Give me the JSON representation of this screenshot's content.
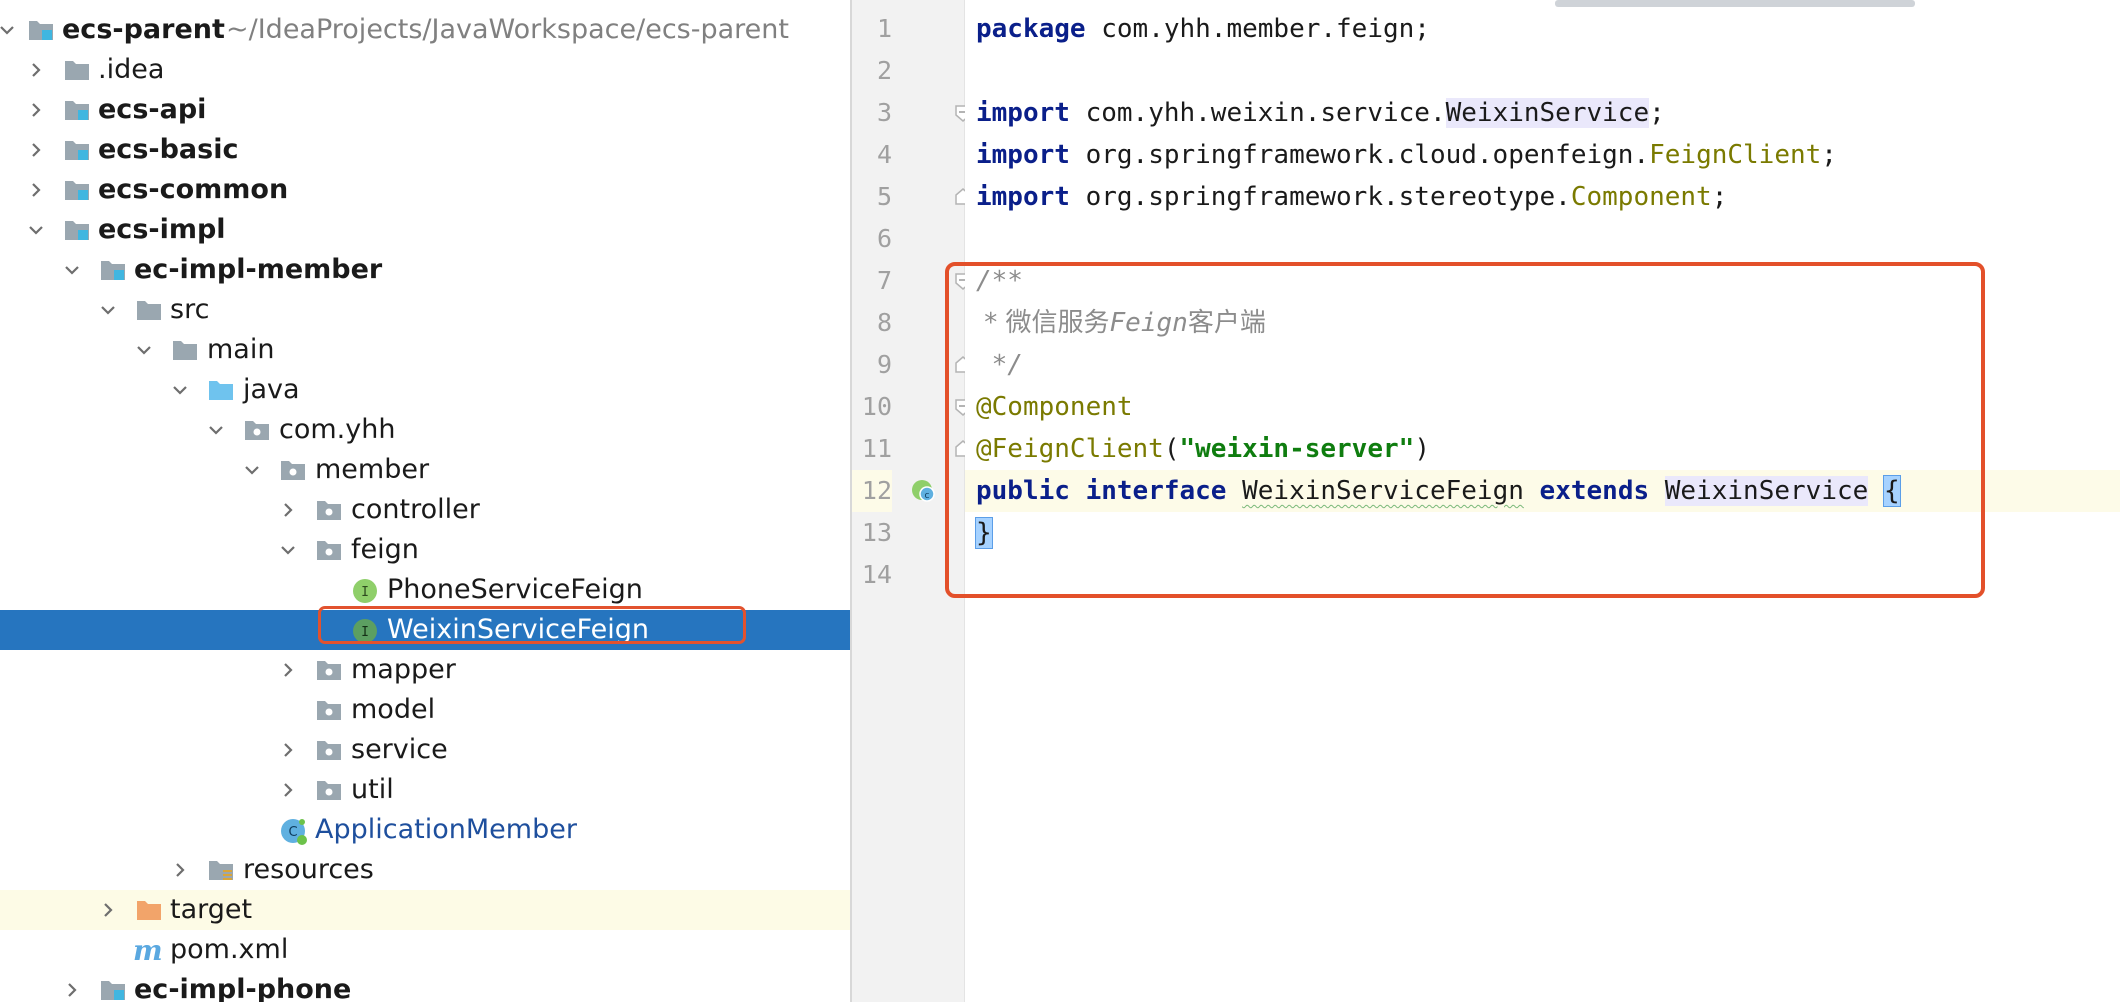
{
  "tree": {
    "root": {
      "name": "ecs-parent",
      "path": "~/IdeaProjects/JavaWorkspace/ecs-parent"
    },
    "nodes": [
      {
        "label": ".idea"
      },
      {
        "label": "ecs-api"
      },
      {
        "label": "ecs-basic"
      },
      {
        "label": "ecs-common"
      },
      {
        "label": "ecs-impl"
      },
      {
        "label": "ec-impl-member"
      },
      {
        "label": "src"
      },
      {
        "label": "main"
      },
      {
        "label": "java"
      },
      {
        "label": "com.yhh"
      },
      {
        "label": "member"
      },
      {
        "label": "controller"
      },
      {
        "label": "feign"
      },
      {
        "label": "PhoneServiceFeign"
      },
      {
        "label": "WeixinServiceFeign"
      },
      {
        "label": "mapper"
      },
      {
        "label": "model"
      },
      {
        "label": "service"
      },
      {
        "label": "util"
      },
      {
        "label": "ApplicationMember"
      },
      {
        "label": "resources"
      },
      {
        "label": "target"
      },
      {
        "label": "pom.xml"
      },
      {
        "label": "ec-impl-phone"
      }
    ],
    "interface_badge": "I",
    "selected_item": "WeixinServiceFeign"
  },
  "editor": {
    "line_numbers": [
      "1",
      "2",
      "3",
      "4",
      "5",
      "6",
      "7",
      "8",
      "9",
      "10",
      "11",
      "12",
      "13",
      "14"
    ],
    "current_line": 12,
    "lines": {
      "l1_kw": "package",
      "l1_rest": " com.yhh.member.feign;",
      "l3_kw": "import",
      "l3_pkg": " com.yhh.weixin.service.",
      "l3_cls": "WeixinService",
      "l3_end": ";",
      "l4_kw": "import",
      "l4_pkg": " org.springframework.cloud.openfeign.",
      "l4_cls": "FeignClient",
      "l4_end": ";",
      "l5_kw": "import",
      "l5_pkg": " org.springframework.stereotype.",
      "l5_cls": "Component",
      "l5_end": ";",
      "l7": "/**",
      "l8_a": " * 微信服务",
      "l8_b": "Feign",
      "l8_c": "客户端",
      "l9": " */",
      "l10": "@Component",
      "l11_ann": "@FeignClient",
      "l11_open": "(",
      "l11_str": "\"weixin-server\"",
      "l11_close": ")",
      "l12_kw1": "public",
      "l12_kw2": "interface",
      "l12_name": "WeixinServiceFeign",
      "l12_kw3": "extends",
      "l12_parent": "WeixinService",
      "l12_brace": "{",
      "l13": "}"
    }
  },
  "colors": {
    "selection": "#2675bf",
    "highlight_box": "#e3502a",
    "keyword": "#0a1f8a",
    "annotation": "#7a7a00",
    "string": "#0f7d0f",
    "comment": "#8c8c8c"
  },
  "icons": {
    "expand": "chevron-right-icon",
    "collapse": "chevron-down-icon",
    "folder": "folder-icon",
    "module": "module-folder-icon",
    "package": "package-icon",
    "source-root": "source-root-icon",
    "interface": "interface-icon",
    "class": "spring-boot-class-icon",
    "resources": "resources-folder-icon",
    "excluded": "excluded-folder-icon",
    "maven": "maven-pom-icon",
    "gutter": "implemented-by-icon"
  }
}
